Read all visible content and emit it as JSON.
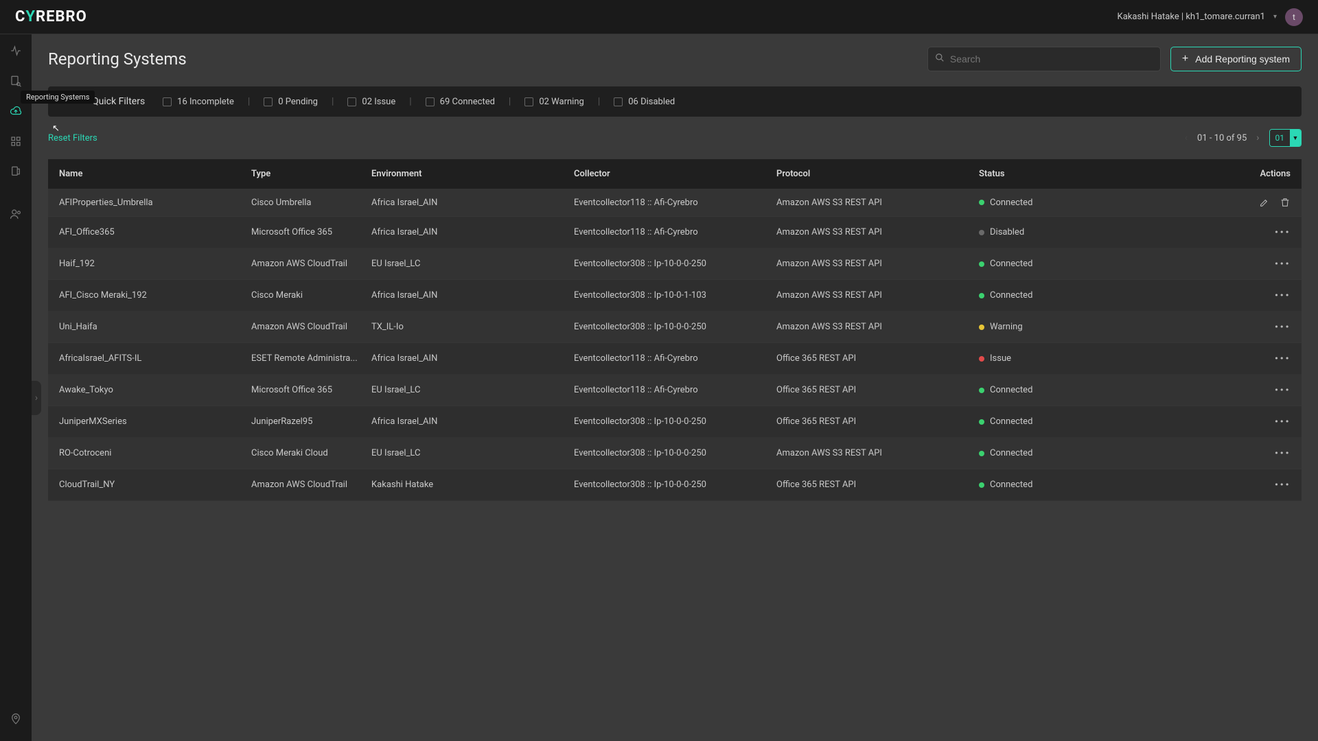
{
  "brand": {
    "pre": "C",
    "accent": "Y",
    "post": "REBRO"
  },
  "user": {
    "display": "Kakashi Hatake | kh1_tomare.curran1",
    "avatar": "t"
  },
  "page": {
    "title": "Reporting Systems"
  },
  "search": {
    "placeholder": "Search"
  },
  "add_button": "Add Reporting system",
  "tooltip": "Reporting Systems",
  "quick_filters": {
    "title": "Quick Filters",
    "items": [
      {
        "count": "16",
        "label": "Incomplete"
      },
      {
        "count": "0",
        "label": "Pending"
      },
      {
        "count": "02",
        "label": "Issue"
      },
      {
        "count": "69",
        "label": "Connected"
      },
      {
        "count": "02",
        "label": "Warning"
      },
      {
        "count": "06",
        "label": "Disabled"
      }
    ]
  },
  "reset_label": "Reset Filters",
  "pagination": {
    "range": "01 - 10 of 95",
    "page": "01"
  },
  "columns": {
    "name": "Name",
    "type": "Type",
    "env": "Environment",
    "collector": "Collector",
    "protocol": "Protocol",
    "status": "Status",
    "actions": "Actions"
  },
  "rows": [
    {
      "name": "AFIProperties_Umbrella",
      "type": "Cisco Umbrella",
      "env": "Africa Israel_AIN",
      "collector": "Eventcollector118 :: Afi-Cyrebro",
      "protocol": "Amazon AWS S3 REST API",
      "status": "Connected",
      "actions": "edit"
    },
    {
      "name": "AFI_Office365",
      "type": "Microsoft Office 365",
      "env": "Africa Israel_AIN",
      "collector": "Eventcollector118 :: Afi-Cyrebro",
      "protocol": "Amazon AWS S3 REST API",
      "status": "Disabled",
      "actions": "more"
    },
    {
      "name": "Haif_192",
      "type": "Amazon AWS CloudTrail",
      "env": "EU Israel_LC",
      "collector": "Eventcollector308 :: Ip-10-0-0-250",
      "protocol": "Amazon AWS S3 REST API",
      "status": "Connected",
      "actions": "more"
    },
    {
      "name": "AFI_Cisco Meraki_192",
      "type": "Cisco Meraki",
      "env": "Africa Israel_AIN",
      "collector": "Eventcollector308 :: Ip-10-0-1-103",
      "protocol": "Amazon AWS S3 REST API",
      "status": "Connected",
      "actions": "more"
    },
    {
      "name": "Uni_Haifa",
      "type": "Amazon AWS CloudTrail",
      "env": "TX_IL-Io",
      "collector": "Eventcollector308 :: Ip-10-0-0-250",
      "protocol": "Amazon AWS S3 REST API",
      "status": "Warning",
      "actions": "more"
    },
    {
      "name": "AfricaIsrael_AFITS-IL",
      "type": "ESET Remote Administra...",
      "env": "Africa Israel_AIN",
      "collector": "Eventcollector118 :: Afi-Cyrebro",
      "protocol": "Office 365 REST API",
      "status": "Issue",
      "actions": "more"
    },
    {
      "name": "Awake_Tokyo",
      "type": "Microsoft Office 365",
      "env": "EU Israel_LC",
      "collector": "Eventcollector118 :: Afi-Cyrebro",
      "protocol": "Office 365 REST API",
      "status": "Connected",
      "actions": "more"
    },
    {
      "name": "JuniperMXSeries",
      "type": "JuniperRazel95",
      "env": "Africa Israel_AIN",
      "collector": "Eventcollector308 :: Ip-10-0-0-250",
      "protocol": "Office 365 REST API",
      "status": "Connected",
      "actions": "more"
    },
    {
      "name": "RO-Cotroceni",
      "type": "Cisco Meraki Cloud",
      "env": "EU Israel_LC",
      "collector": "Eventcollector308 :: Ip-10-0-0-250",
      "protocol": "Amazon AWS S3 REST API",
      "status": "Connected",
      "actions": "more"
    },
    {
      "name": "CloudTrail_NY",
      "type": "Amazon AWS CloudTrail",
      "env": "Kakashi Hatake",
      "collector": "Eventcollector308 :: Ip-10-0-0-250",
      "protocol": "Office 365 REST API",
      "status": "Connected",
      "actions": "more"
    }
  ]
}
